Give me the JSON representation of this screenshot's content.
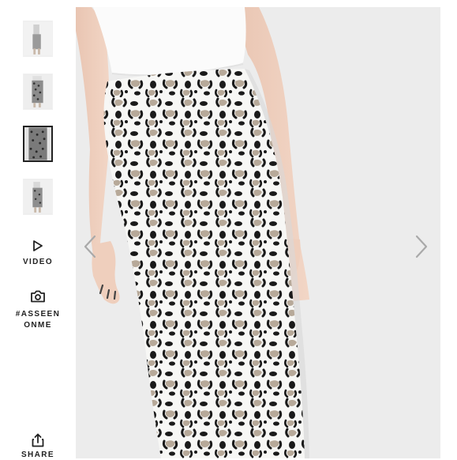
{
  "gallery": {
    "thumbnails": [
      {
        "name": "thumbnail-1",
        "active": false
      },
      {
        "name": "thumbnail-2",
        "active": false
      },
      {
        "name": "thumbnail-3",
        "active": true
      },
      {
        "name": "thumbnail-4",
        "active": false
      }
    ],
    "video_label": "VIDEO",
    "as_seen_on_me_label_line1": "#ASSEEN",
    "as_seen_on_me_label_line2": "ONME",
    "share_label": "SHARE"
  },
  "colors": {
    "background": "#ffffff",
    "photo_background": "#ececec",
    "text": "#222222",
    "print_dark": "#1a1a1a",
    "print_tan": "#b7a999"
  },
  "icons": {
    "video": "play-icon",
    "as_seen_on_me": "camera-icon",
    "share": "share-icon",
    "previous": "chevron-left-icon",
    "next": "chevron-right-icon"
  }
}
